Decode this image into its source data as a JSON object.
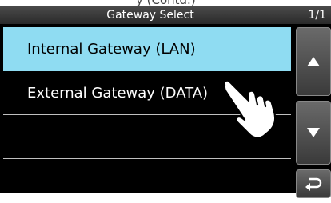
{
  "top_partial_text": "y (Contd.)",
  "dialog": {
    "title": "Gateway Select",
    "page_indicator": "1/1"
  },
  "options": [
    {
      "label": "Internal Gateway (LAN)",
      "selected": true
    },
    {
      "label": "External Gateway (DATA)",
      "selected": false
    },
    {
      "label": "",
      "selected": false
    },
    {
      "label": "",
      "selected": false
    }
  ],
  "buttons": {
    "up": "up-arrow-icon",
    "down": "down-arrow-icon",
    "back": "return-icon"
  },
  "colors": {
    "selected_row": "#8fdcf2",
    "background": "#000000",
    "button": "#4a4a4a"
  }
}
